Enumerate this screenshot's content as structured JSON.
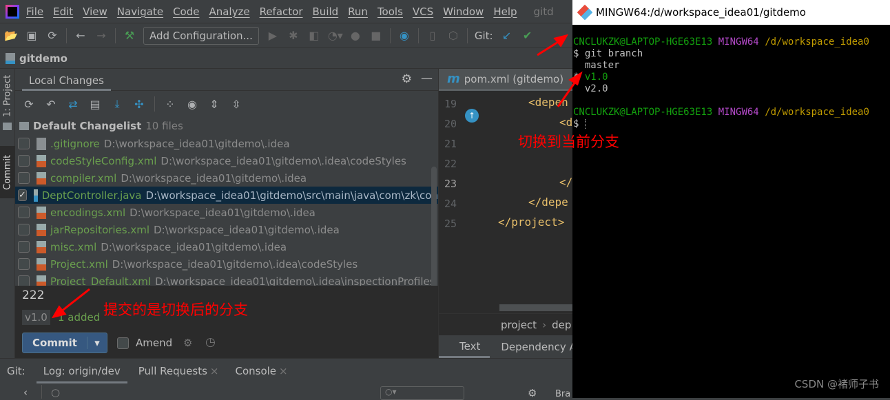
{
  "menu": [
    "File",
    "Edit",
    "View",
    "Navigate",
    "Code",
    "Analyze",
    "Refactor",
    "Build",
    "Run",
    "Tools",
    "VCS",
    "Window",
    "Help"
  ],
  "window_title_partial": "gitd",
  "toolbar": {
    "add_configuration": "Add Configuration...",
    "git_label": "Git:"
  },
  "navbar": {
    "project": "gitdemo"
  },
  "side_tabs": {
    "project": "1: Project",
    "commit": "Commit"
  },
  "commit_panel": {
    "tab": "Local Changes",
    "changelist": {
      "name": "Default Changelist",
      "count": "10 files"
    },
    "files": [
      {
        "name": ".gitignore",
        "path": "D:\\workspace_idea01\\gitdemo\\.idea",
        "checked": false,
        "type": "plain"
      },
      {
        "name": "codeStyleConfig.xml",
        "path": "D:\\workspace_idea01\\gitdemo\\.idea\\codeStyles",
        "checked": false,
        "type": "xml"
      },
      {
        "name": "compiler.xml",
        "path": "D:\\workspace_idea01\\gitdemo\\.idea",
        "checked": false,
        "type": "xml"
      },
      {
        "name": "DeptController.java",
        "path": "D:\\workspace_idea01\\gitdemo\\src\\main\\java\\com\\zk\\con",
        "checked": true,
        "type": "java"
      },
      {
        "name": "encodings.xml",
        "path": "D:\\workspace_idea01\\gitdemo\\.idea",
        "checked": false,
        "type": "xml"
      },
      {
        "name": "jarRepositories.xml",
        "path": "D:\\workspace_idea01\\gitdemo\\.idea",
        "checked": false,
        "type": "xml"
      },
      {
        "name": "misc.xml",
        "path": "D:\\workspace_idea01\\gitdemo\\.idea",
        "checked": false,
        "type": "xml"
      },
      {
        "name": "Project.xml",
        "path": "D:\\workspace_idea01\\gitdemo\\.idea\\codeStyles",
        "checked": false,
        "type": "xml"
      },
      {
        "name": "Project_Default.xml",
        "path": "D:\\workspace_idea01\\gitdemo\\.idea\\inspectionProfiles",
        "checked": false,
        "type": "xml"
      }
    ],
    "commit_message": "222",
    "branch": "v1.0",
    "status": "1 added",
    "commit_button": "Commit",
    "amend_label": "Amend"
  },
  "editor": {
    "tab": "pom.xml (gitdemo)",
    "lines": [
      "19",
      "20",
      "21",
      "22",
      "23",
      "24",
      "25"
    ],
    "code": [
      "<depen",
      "<d",
      "",
      "",
      "</",
      "</depe",
      "</project>"
    ],
    "breadcrumb": [
      "project",
      "dep"
    ],
    "bottom_tabs": [
      "Text",
      "Dependency A"
    ]
  },
  "bottom": {
    "label": "Git:",
    "tabs": [
      "Log: origin/dev",
      "Pull Requests",
      "Console"
    ],
    "branches_partial": "Bra"
  },
  "terminal": {
    "title": "MINGW64:/d/workspace_idea01/gitdemo",
    "user": "CNCLUKZK@LAPTOP-HGE63E13",
    "env": "MINGW64",
    "path": "/d/workspace_idea0",
    "command": "$ git branch",
    "branches": [
      {
        "name": "master",
        "current": false
      },
      {
        "name": "v1.0",
        "current": true
      },
      {
        "name": "v2.0",
        "current": false
      }
    ],
    "prompt": "$"
  },
  "annotations": {
    "switch": "切换到当前分支",
    "committed": "提交的是切换后的分支"
  },
  "watermark": "CSDN @褚师子书",
  "colors": {
    "accent": "#4a88c7",
    "annotation": "#ff0000",
    "file_added": "#6a9f4e",
    "term_user": "#13a10e",
    "term_env": "#b148c6",
    "term_path": "#c19c00"
  }
}
